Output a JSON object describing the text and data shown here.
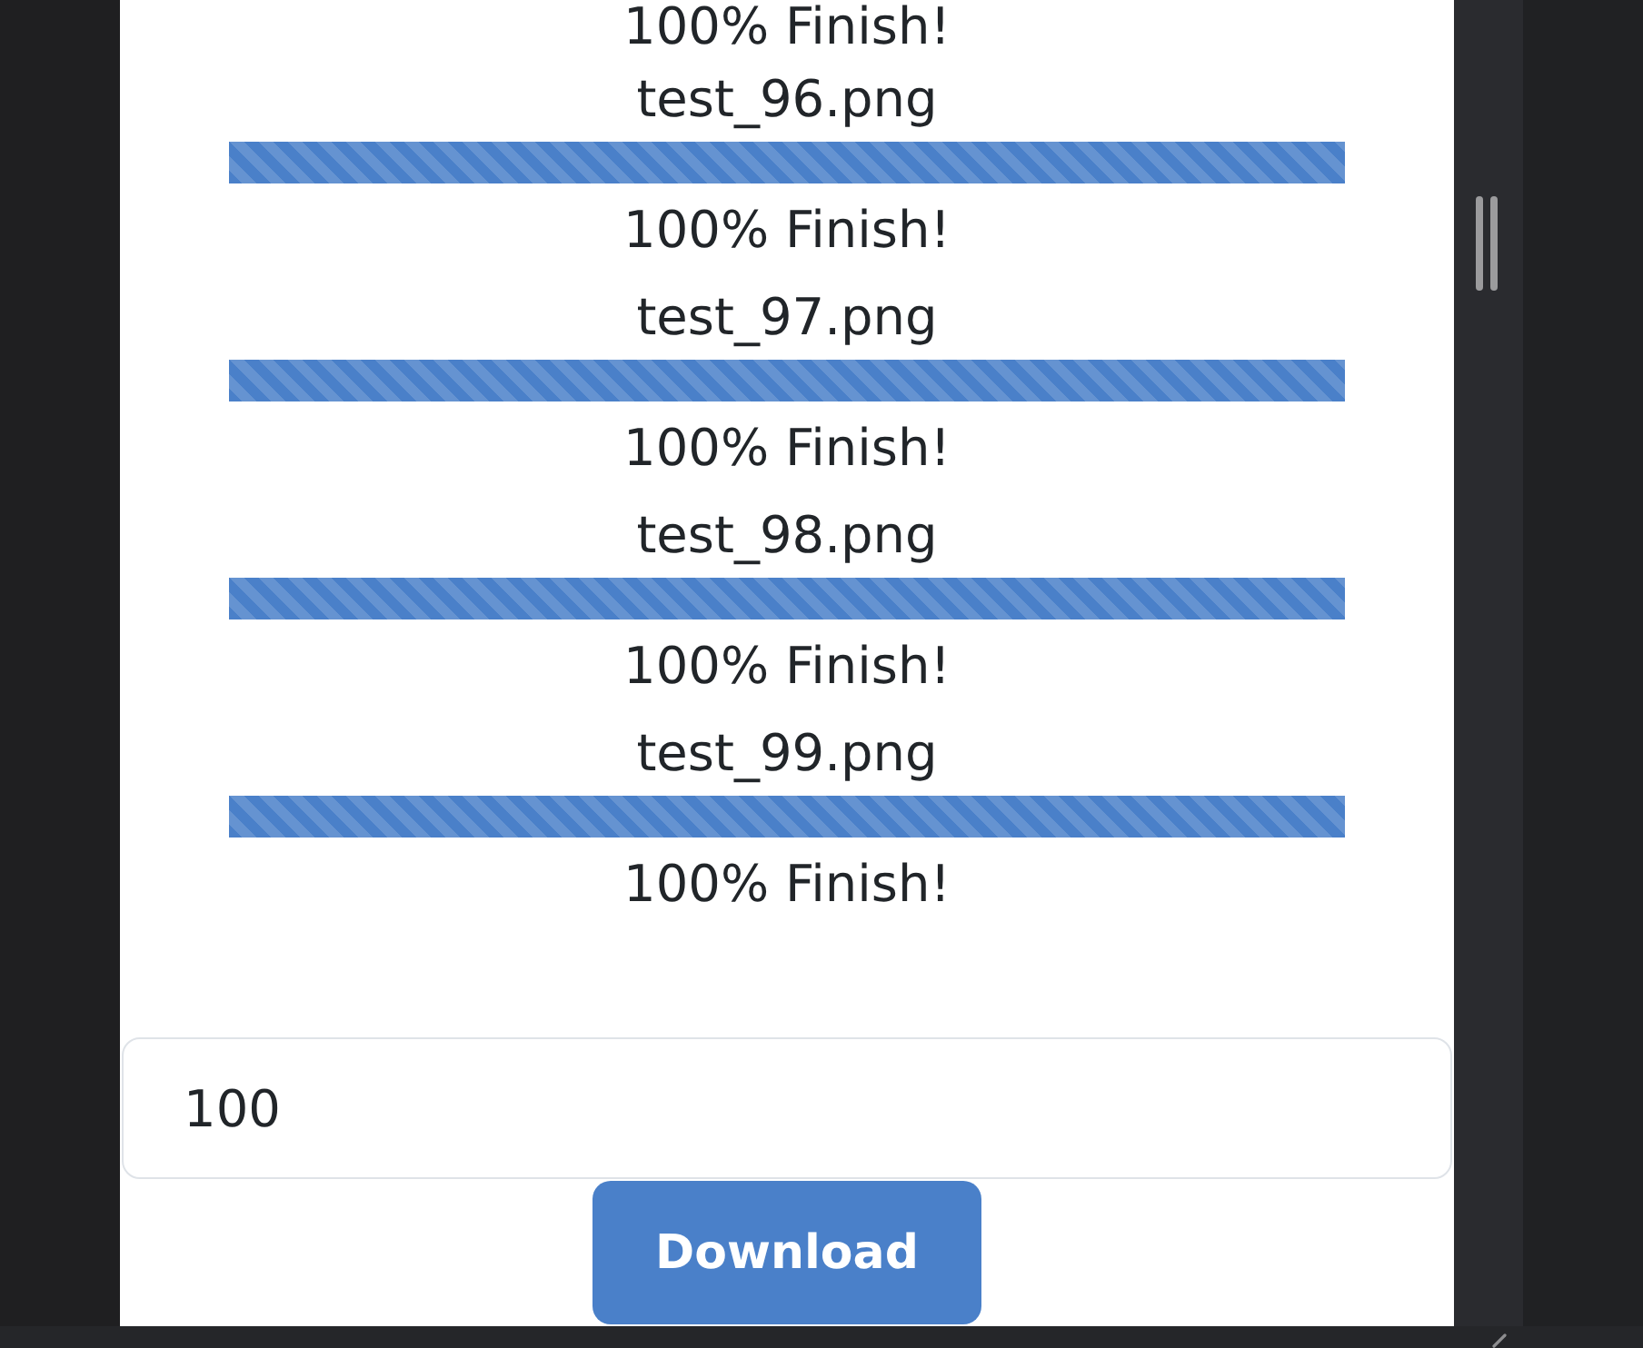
{
  "uploads": [
    {
      "status": "100% Finish!"
    },
    {
      "file": "test_96.png",
      "level": 1,
      "status": "100% Finish!"
    },
    {
      "file": "test_97.png",
      "level": 1,
      "status": "100% Finish!"
    },
    {
      "file": "test_98.png",
      "level": 1,
      "status": "100% Finish!"
    },
    {
      "file": "test_99.png",
      "level": 1,
      "status": "100% Finish!"
    }
  ],
  "count_field": {
    "value": "100"
  },
  "download_button": {
    "label": "Download"
  }
}
